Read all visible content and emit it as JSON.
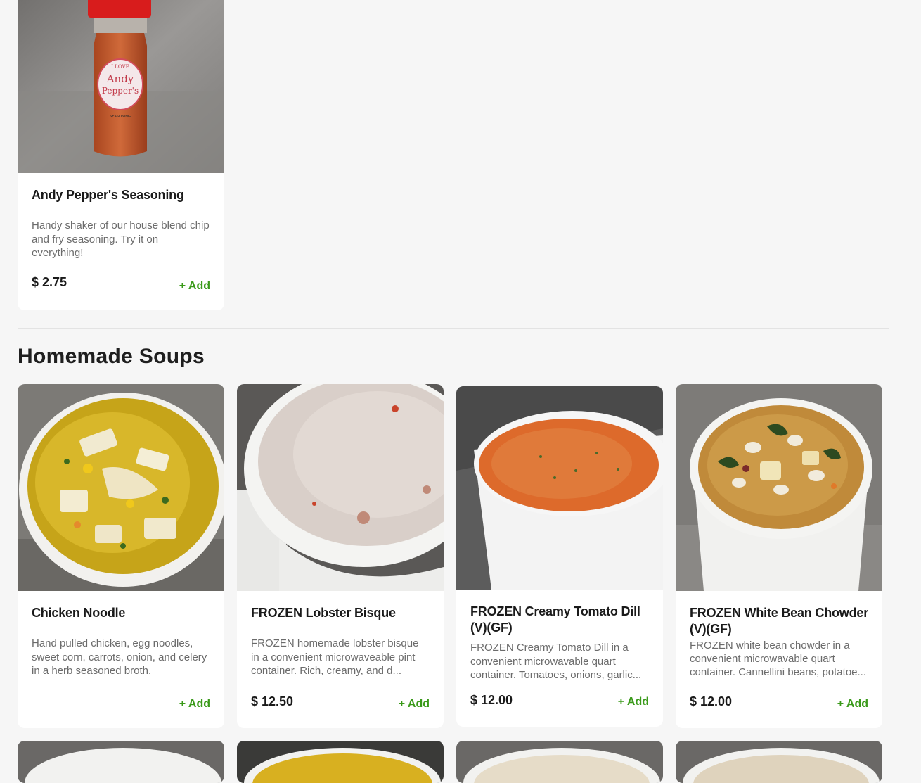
{
  "seasoning": {
    "title": "Andy Pepper's Seasoning",
    "description": "Handy shaker of our house blend chip and fry seasoning. Try it on everything!",
    "price": "$ 2.75",
    "add_label": "+ Add",
    "label_text": [
      "I LOVE",
      "Andy",
      "Pepper's",
      "SEASONING"
    ]
  },
  "section": {
    "title": "Homemade Soups"
  },
  "soups": [
    {
      "title": "Chicken Noodle",
      "description": "Hand pulled chicken, egg noodles, sweet corn, carrots, onion, and celery in a herb seasoned broth.",
      "price": "",
      "add_label": "+ Add"
    },
    {
      "title": "FROZEN Lobster Bisque",
      "description": "FROZEN homemade lobster bisque in a convenient microwaveable pint container. Rich, creamy, and d...",
      "price": "$ 12.50",
      "add_label": "+ Add"
    },
    {
      "title": "FROZEN Creamy Tomato Dill (V)(GF)",
      "description": "FROZEN Creamy Tomato Dill in a convenient microwavable quart container. Tomatoes, onions, garlic...",
      "price": "$ 12.00",
      "add_label": "+ Add"
    },
    {
      "title": "FROZEN White Bean Chowder (V)(GF)",
      "description": "FROZEN white bean chowder in a convenient microwavable quart container. Cannellini beans, potatoe...",
      "price": "$ 12.00",
      "add_label": "+ Add"
    }
  ],
  "colors": {
    "accent": "#3a9a1a",
    "background": "#f6f6f6",
    "card": "#ffffff"
  }
}
